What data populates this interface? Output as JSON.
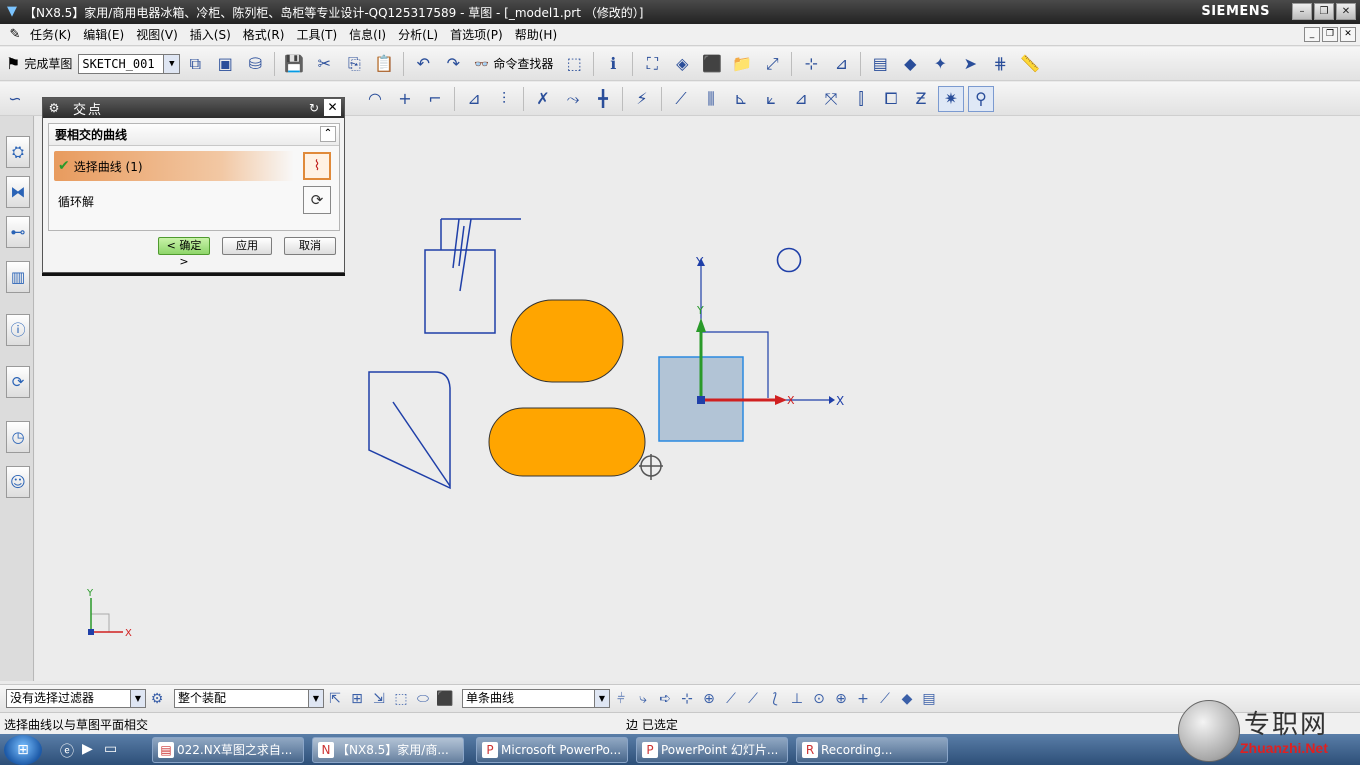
{
  "window": {
    "title": "【NX8.5】家用/商用电器冰箱、冷柜、陈列柜、岛柜等专业设计-QQ125317589 - 草图 - [_model1.prt （修改的）]",
    "brand": "SIEMENS"
  },
  "menu": [
    "任务(K)",
    "编辑(E)",
    "视图(V)",
    "插入(S)",
    "格式(R)",
    "工具(T)",
    "信息(I)",
    "分析(L)",
    "首选项(P)",
    "帮助(H)"
  ],
  "toolbar": {
    "finish_sketch": "完成草图",
    "sketch_name": "SKETCH_001",
    "command_finder": "命令查找器"
  },
  "dialog": {
    "title": "交点",
    "group_label": "要相交的曲线",
    "select_curve": "选择曲线 (1)",
    "cycle_solution": "循环解",
    "ok": "< 确定 >",
    "apply": "应用",
    "cancel": "取消"
  },
  "selection_bar": {
    "filter": "没有选择过滤器",
    "scope": "整个装配",
    "curve_rule": "单条曲线"
  },
  "status": {
    "prompt": "选择曲线以与草图平面相交",
    "state": "边 已选定"
  },
  "taskbar": {
    "tasks": [
      "022.NX草图之求自...",
      "【NX8.5】家用/商...",
      "Microsoft PowerPo...",
      "PowerPoint 幻灯片...",
      "Recording..."
    ]
  },
  "axes": {
    "x": "X",
    "y": "Y"
  },
  "watermark": {
    "text": "专职网",
    "url": "Zhuanzhi.Net"
  },
  "colors": {
    "fill_orange": "#ffa500",
    "sketch_blue": "#1f3fa8",
    "csys_red": "#d02020",
    "csys_green": "#2a9a2a"
  }
}
